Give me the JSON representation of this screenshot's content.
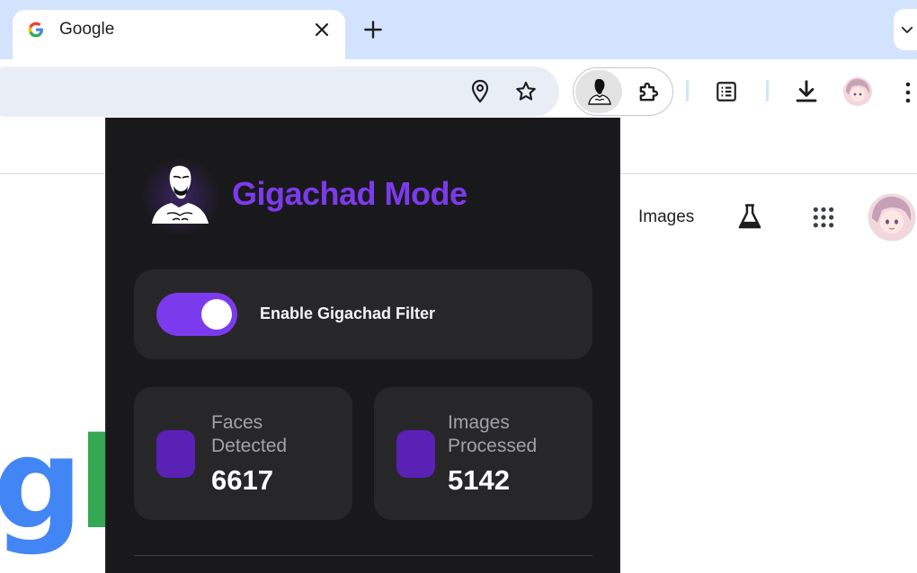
{
  "browser": {
    "tab": {
      "title": "Google",
      "favicon": "google-g-icon",
      "close_icon": "close-icon"
    },
    "new_tab_icon": "plus-icon",
    "toolbar": {
      "icons": [
        "location-pin-icon",
        "bookmark-star-icon",
        "gigachad-extension-icon",
        "puzzle-extensions-icon",
        "reading-list-icon",
        "download-icon",
        "profile-avatar",
        "kebab-menu-icon"
      ]
    }
  },
  "google_page": {
    "images_link": "Images",
    "logo_partial": "gle",
    "colors": {
      "g": "#34a853",
      "l": "#34a853",
      "e": "#ea4335",
      "blue": "#4285f4"
    }
  },
  "popup": {
    "title": "Gigachad Mode",
    "accent_color": "#7c3aed",
    "toggle": {
      "label": "Enable Gigachad Filter",
      "enabled": true
    },
    "stats": [
      {
        "label_line1": "Faces",
        "label_line2": "Detected",
        "value": "6617"
      },
      {
        "label_line1": "Images",
        "label_line2": "Processed",
        "value": "5142"
      }
    ]
  }
}
